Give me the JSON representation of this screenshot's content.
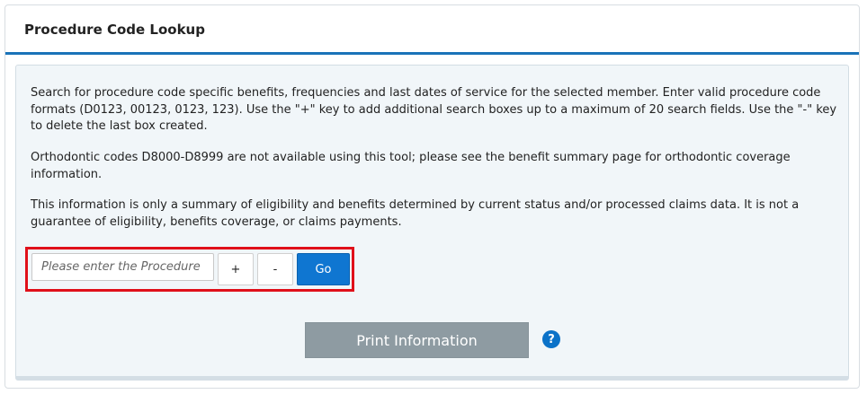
{
  "header": {
    "title": "Procedure Code Lookup"
  },
  "intro": {
    "p1": "Search for procedure code specific benefits, frequencies and last dates of service for the selected member. Enter valid procedure code formats (D0123, 00123, 0123, 123). Use the \"+\" key to add additional search boxes up to a maximum of 20 search fields. Use the \"-\" key to delete the last box created.",
    "p2": "Orthodontic codes D8000-D8999 are not available using this tool; please see the benefit summary page for orthodontic coverage information.",
    "p3": "This information is only a summary of eligibility and benefits determined by current status and/or processed claims data. It is not a guarantee of eligibility, benefits coverage, or claims payments."
  },
  "search": {
    "placeholder": "Please enter the Procedure",
    "value": "",
    "add_label": "+",
    "remove_label": "-",
    "go_label": "Go",
    "highlight_color": "#e0101a"
  },
  "actions": {
    "print_label": "Print Information",
    "help_label": "?"
  },
  "colors": {
    "accent": "#1a73b8",
    "go_button": "#0f76d1",
    "print_button": "#8e9ba2"
  }
}
